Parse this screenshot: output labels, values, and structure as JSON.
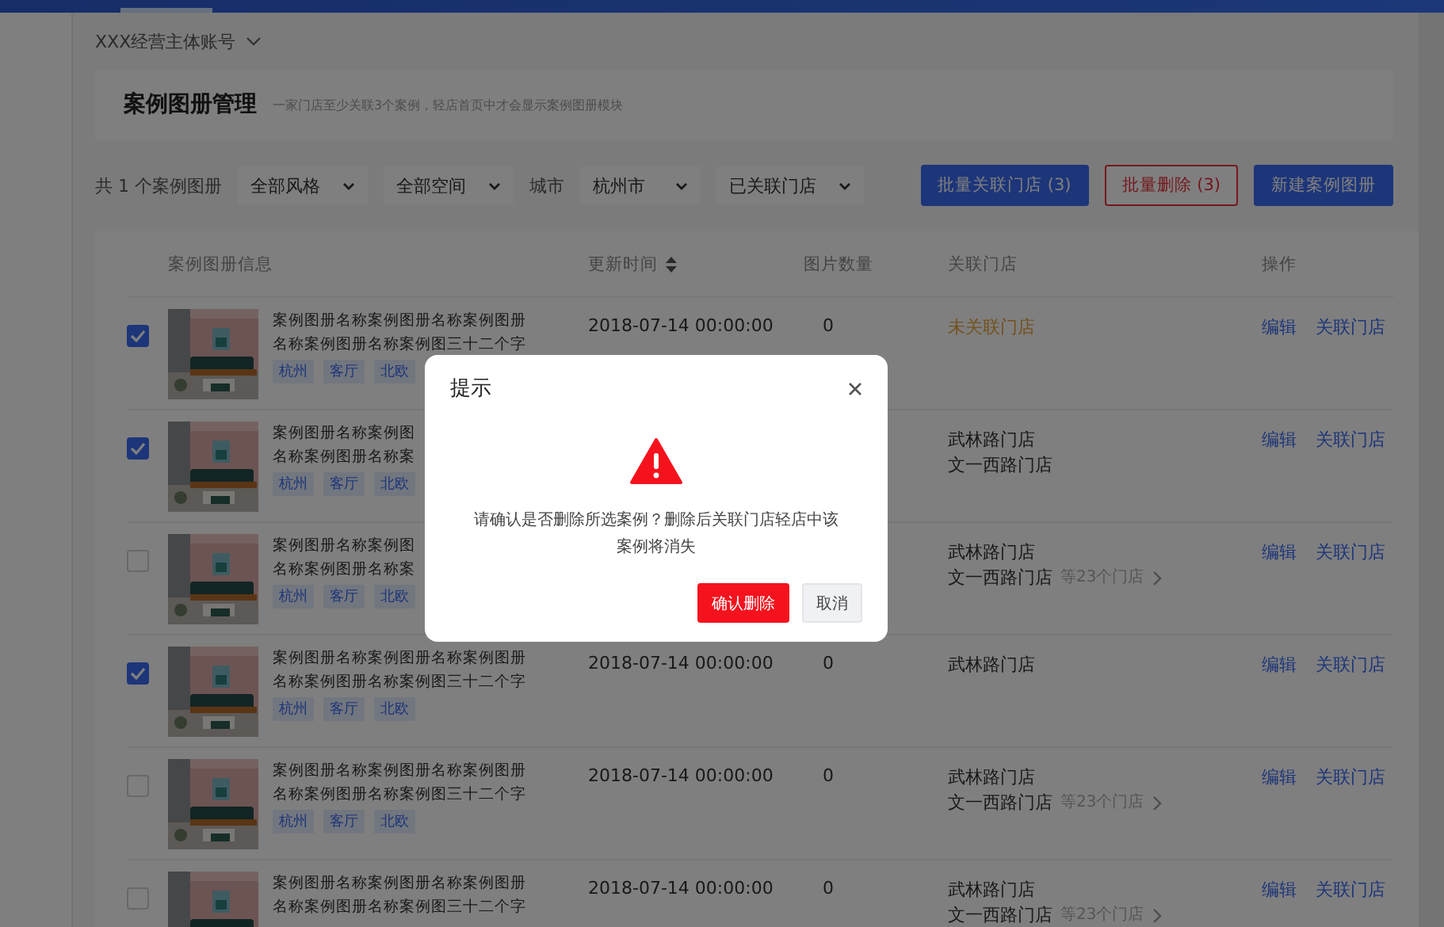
{
  "breadcrumb": "XXX经营主体账号",
  "header": {
    "title": "案例图册管理",
    "hint": "一家门店至少关联3个案例，轻店首页中才会显示案例图册模块"
  },
  "toolbar": {
    "count": "共 1 个案例图册",
    "filters": [
      {
        "kind": "select",
        "value": "全部风格"
      },
      {
        "kind": "select",
        "value": "全部空间"
      },
      {
        "kind": "label",
        "value": "城市"
      },
      {
        "kind": "select",
        "value": "杭州市"
      },
      {
        "kind": "select",
        "value": "已关联门店"
      }
    ],
    "buttons": [
      {
        "kind": "primary",
        "label": "批量关联门店 (3)"
      },
      {
        "kind": "danger",
        "label": "批量删除 (3)"
      },
      {
        "kind": "primary",
        "label": "新建案例图册"
      }
    ]
  },
  "table": {
    "columns": [
      "案例图册信息",
      "更新时间",
      "图片数量",
      "关联门店",
      "操作"
    ],
    "rows": [
      {
        "checked": true,
        "name": [
          "案例图册名称案例图册名称案例图册",
          "名称案例图册名称案例图三十二个字"
        ],
        "tags": [
          "杭州",
          "客厅",
          "北欧"
        ],
        "time": "2018-07-14 00:00:00",
        "count": "0",
        "stores": {
          "kind": "none",
          "lines": [
            "未关联门店"
          ]
        },
        "actions": [
          "编辑",
          "关联门店"
        ]
      },
      {
        "checked": true,
        "name": [
          "案例图册名称案例图",
          "名称案例图册名称案"
        ],
        "tags": [
          "杭州",
          "客厅",
          "北欧"
        ],
        "stores": {
          "kind": "list",
          "lines": [
            "武林路门店",
            "文一西路门店"
          ]
        },
        "actions": [
          "编辑",
          "关联门店"
        ]
      },
      {
        "checked": false,
        "name": [
          "案例图册名称案例图",
          "名称案例图册名称案"
        ],
        "tags": [
          "杭州",
          "客厅",
          "北欧"
        ],
        "stores": {
          "kind": "list",
          "lines": [
            "武林路门店",
            "文一西路门店"
          ],
          "more": "等23个门店"
        },
        "actions": [
          "编辑",
          "关联门店"
        ]
      },
      {
        "checked": true,
        "name": [
          "案例图册名称案例图册名称案例图册",
          "名称案例图册名称案例图三十二个字"
        ],
        "tags": [
          "杭州",
          "客厅",
          "北欧"
        ],
        "time": "2018-07-14 00:00:00",
        "count": "0",
        "stores": {
          "kind": "list",
          "lines": [
            "武林路门店"
          ]
        },
        "actions": [
          "编辑",
          "关联门店"
        ]
      },
      {
        "checked": false,
        "name": [
          "案例图册名称案例图册名称案例图册",
          "名称案例图册名称案例图三十二个字"
        ],
        "tags": [
          "杭州",
          "客厅",
          "北欧"
        ],
        "time": "2018-07-14 00:00:00",
        "count": "0",
        "stores": {
          "kind": "list",
          "lines": [
            "武林路门店",
            "文一西路门店"
          ],
          "more": "等23个门店"
        },
        "actions": [
          "编辑",
          "关联门店"
        ]
      },
      {
        "checked": false,
        "name": [
          "案例图册名称案例图册名称案例图册",
          "名称案例图册名称案例图三十二个字"
        ],
        "time": "2018-07-14 00:00:00",
        "count": "0",
        "stores": {
          "kind": "list",
          "lines": [
            "武林路门店",
            "文一西路门店"
          ],
          "more": "等23个门店"
        },
        "actions": [
          "编辑",
          "关联门店"
        ]
      }
    ]
  },
  "dialog": {
    "title": "提示",
    "message": "请确认是否删除所选案例？删除后关联门店轻店中该案例将消失",
    "buttons": [
      {
        "kind": "danger",
        "label": "确认删除"
      },
      {
        "kind": "default",
        "label": "取消"
      }
    ]
  }
}
